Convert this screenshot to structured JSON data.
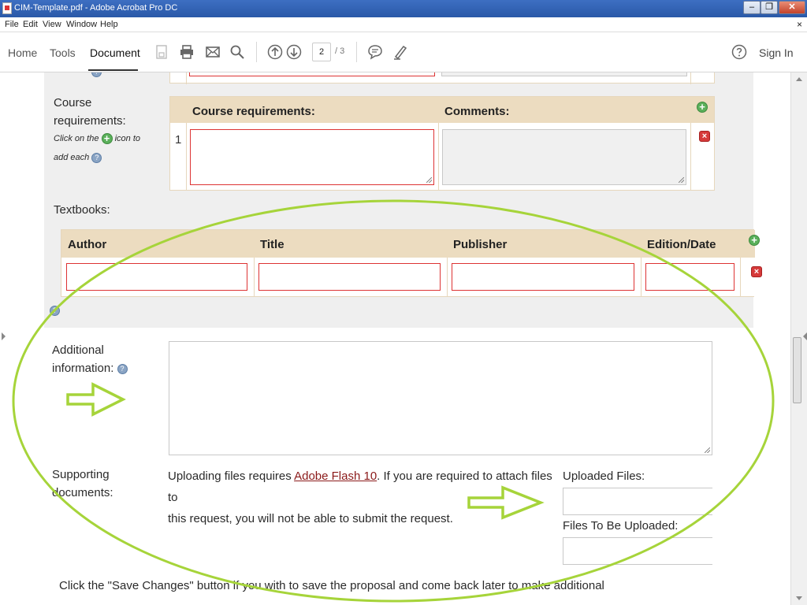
{
  "window": {
    "title": "CIM-Template.pdf - Adobe Acrobat Pro DC",
    "min_glyph": "–",
    "max_glyph": "❐",
    "close_glyph": "✕"
  },
  "menu": {
    "items": [
      "File",
      "Edit",
      "View",
      "Window",
      "Help"
    ],
    "close_glyph": "×"
  },
  "toolbar": {
    "tabs": [
      "Home",
      "Tools",
      "Document"
    ],
    "active_tab": "Document",
    "current_page": "2",
    "total_pages": "/ 3",
    "sign_in": "Sign In",
    "icons": [
      "save-icon",
      "print-icon",
      "email-icon",
      "search-icon",
      "page-up-icon",
      "page-down-icon",
      "comment-icon",
      "pen-icon",
      "help-icon"
    ]
  },
  "form": {
    "course_requirements": {
      "label_line1": "Course",
      "label_line2": "requirements:",
      "hint_part1": "Click on the",
      "hint_part2": "icon to",
      "hint_part3": "add each",
      "col_requirements": "Course requirements:",
      "col_comments": "Comments:",
      "row_number": "1"
    },
    "textbooks": {
      "label": "Textbooks:",
      "columns": [
        "Author",
        "Title",
        "Publisher",
        "Edition/Date"
      ]
    },
    "additional_information": {
      "label_line1": "Additional",
      "label_line2": "information:"
    },
    "supporting_documents": {
      "label_line1": "Supporting",
      "label_line2": "documents:",
      "text_before_link": "Uploading files requires ",
      "link_text": "Adobe Flash 10",
      "text_after_link": ". If you are required to attach files to",
      "text_line2": "this request, you will not be able to submit the request.",
      "uploaded_files_label": "Uploaded Files:",
      "files_to_upload_label": "Files To Be Uploaded:"
    },
    "footer_text": "Click the \"Save Changes\" button if you with to save the proposal and come back later to make additional"
  },
  "annotations": {
    "ellipse_color": "#a6d43a"
  }
}
